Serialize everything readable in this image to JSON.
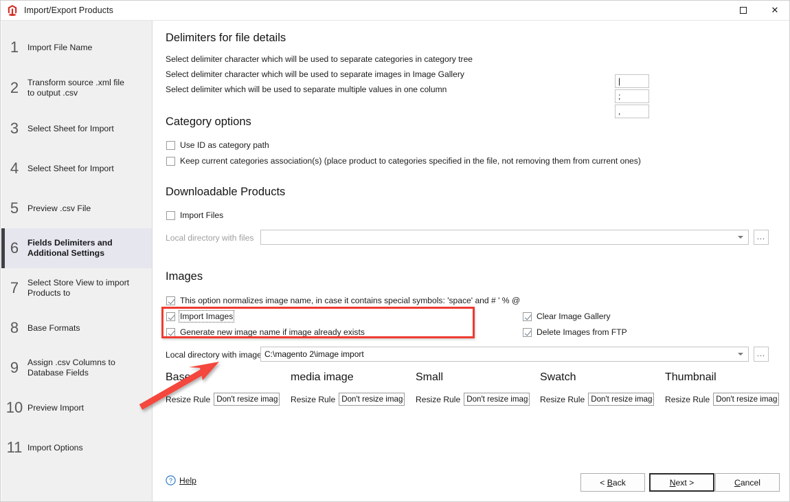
{
  "window": {
    "title": "Import/Export Products",
    "icon": "magento-logo-icon",
    "maximize_label": "",
    "close_label": "✕"
  },
  "sidebar": {
    "steps": [
      {
        "num": "1",
        "label": "Import File Name",
        "active": false
      },
      {
        "num": "2",
        "label": "Transform source .xml file to output .csv",
        "active": false
      },
      {
        "num": "3",
        "label": "Select Sheet for Import",
        "active": false
      },
      {
        "num": "4",
        "label": "Select Sheet for Import",
        "active": false
      },
      {
        "num": "5",
        "label": "Preview .csv File",
        "active": false
      },
      {
        "num": "6",
        "label": "Fields Delimiters and Additional Settings",
        "active": true
      },
      {
        "num": "7",
        "label": "Select Store View to import Products to",
        "active": false
      },
      {
        "num": "8",
        "label": "Base Formats",
        "active": false
      },
      {
        "num": "9",
        "label": "Assign .csv Columns to Database Fields",
        "active": false
      },
      {
        "num": "10",
        "label": "Preview Import",
        "active": false
      },
      {
        "num": "11",
        "label": "Import Options",
        "active": false
      }
    ]
  },
  "delimiters": {
    "title": "Delimiters for file details",
    "rows": [
      {
        "label": "Select delimiter character which will be used to separate categories in category tree",
        "value": "|"
      },
      {
        "label": "Select delimiter character which will be used to separate images in Image Gallery",
        "value": ";"
      },
      {
        "label": "Select delimiter which will be used to separate multiple values in one column",
        "value": ","
      }
    ]
  },
  "category_options": {
    "title": "Category options",
    "items": [
      {
        "label": "Use ID as category path",
        "checked": false
      },
      {
        "label": "Keep current categories association(s) (place product to categories specified in the file, not removing them from current ones)",
        "checked": false
      }
    ]
  },
  "downloadable": {
    "title": "Downloadable Products",
    "import_files": {
      "label": "Import Files",
      "checked": false
    },
    "dir_label": "Local directory with files",
    "dir_value": "",
    "browse_label": "..."
  },
  "images": {
    "title": "Images",
    "normalize": {
      "label": "This option normalizes image name, in case it contains special symbols: 'space' and # ' % @",
      "checked": true
    },
    "import_images": {
      "label": "Import Images",
      "checked": true
    },
    "generate_new_name": {
      "label": "Generate new image name if image already exists",
      "checked": true
    },
    "clear_gallery": {
      "label": "Clear Image Gallery",
      "checked": true
    },
    "delete_ftp": {
      "label": "Delete Images from FTP",
      "checked": true
    },
    "dir_label": "Local directory with images",
    "dir_value": "C:\\magento 2\\image import",
    "browse_label": "..."
  },
  "resize_columns": [
    {
      "title": "Base",
      "rule_label": "Resize Rule",
      "rule_value": "Don't resize imag"
    },
    {
      "title": "media image",
      "rule_label": "Resize Rule",
      "rule_value": "Don't resize imag"
    },
    {
      "title": "Small",
      "rule_label": "Resize Rule",
      "rule_value": "Don't resize imag"
    },
    {
      "title": "Swatch",
      "rule_label": "Resize Rule",
      "rule_value": "Don't resize imag"
    },
    {
      "title": "Thumbnail",
      "rule_label": "Resize Rule",
      "rule_value": "Don't resize imag"
    }
  ],
  "footer": {
    "help_label": "Help",
    "back_label": "< Back",
    "next_label": "Next >",
    "cancel_label": "Cancel"
  },
  "annotations": {
    "highlight_color": "#ee3b31",
    "arrow_color": "#f4463c"
  }
}
